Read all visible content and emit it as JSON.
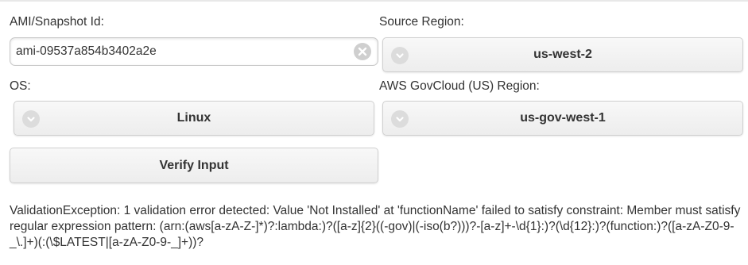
{
  "form": {
    "ami_label": "AMI/Snapshot Id:",
    "ami_value": "ami-09537a854b3402a2e",
    "source_region_label": "Source Region:",
    "source_region_value": "us-west-2",
    "os_label": "OS:",
    "os_value": "Linux",
    "govcloud_label": "AWS GovCloud (US) Region:",
    "govcloud_value": "us-gov-west-1",
    "verify_button": "Verify Input"
  },
  "message": {
    "error_text": "ValidationException: 1 validation error detected: Value 'Not Installed' at 'functionName' failed to satisfy constraint: Member must satisfy regular expression pattern: (arn:(aws[a-zA-Z-]*)?:lambda:)?([a-z]{2}((-gov)|(-iso(b?)))?-[a-z]+-\\d{1}:)?(\\d{12}:)?(function:)?([a-zA-Z0-9-_\\.]+)(:(\\$LATEST|[a-zA-Z0-9-_]+))?"
  },
  "icons": {
    "clear": "clear-icon",
    "chevron": "chevron-down-icon"
  }
}
